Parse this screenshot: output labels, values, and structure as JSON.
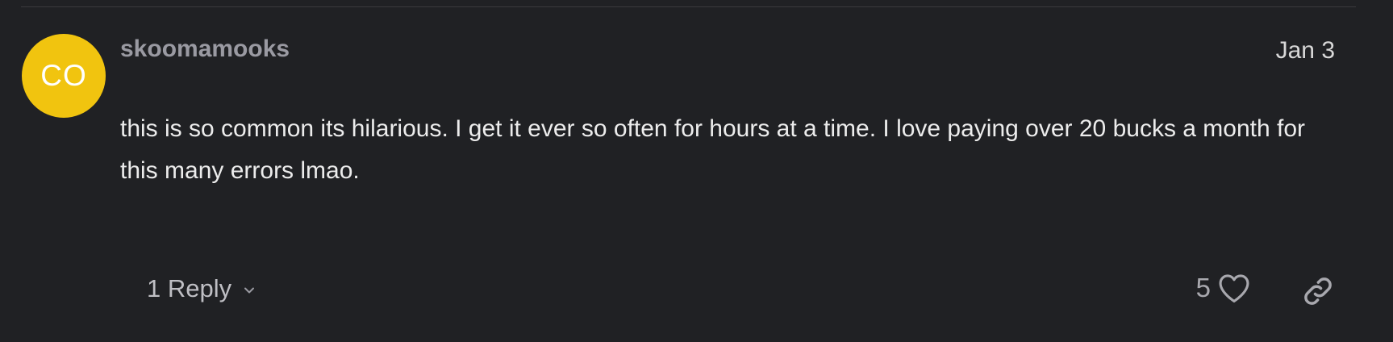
{
  "comment": {
    "avatar_initials": "CO",
    "avatar_color": "#f1c40f",
    "username": "skoomamooks",
    "date": "Jan 3",
    "body": "this is so common its hilarious. I get it ever so often for hours at a time. I love paying over 20 bucks a month for this many errors lmao.",
    "replies_label": "1 Reply",
    "replies_icon": "chevron-down-icon",
    "like_count": "5",
    "like_icon": "heart-icon",
    "share_icon": "link-icon"
  }
}
